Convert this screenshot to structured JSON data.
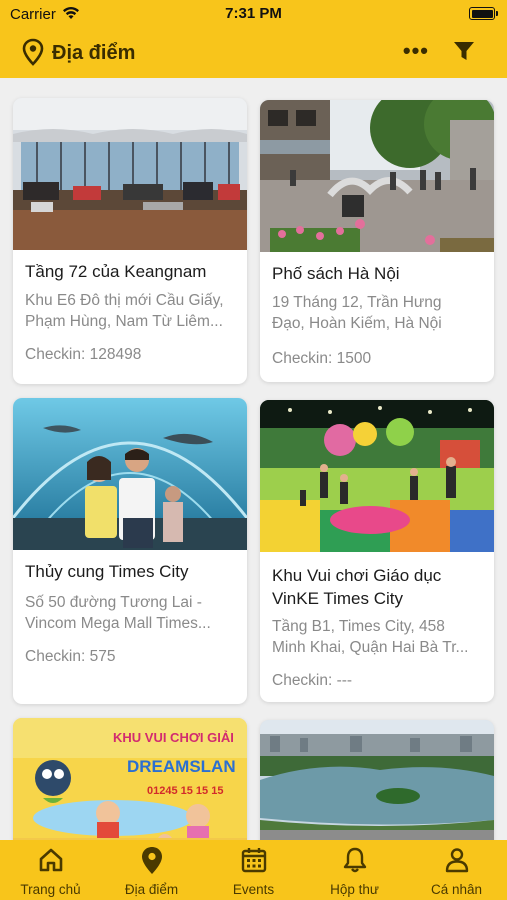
{
  "status_bar": {
    "carrier": "Carrier",
    "time": "7:31 PM",
    "wifi_icon": "wifi-icon",
    "battery_icon": "battery-icon"
  },
  "header": {
    "title": "Địa điểm",
    "title_icon": "location-pin-icon",
    "more_label": "•••",
    "filter_icon": "filter-icon",
    "background": "#f8c51b"
  },
  "places": [
    {
      "title": "Tầng 72 của Keangnam",
      "address": [
        "Khu E6 Đô thị mới Cầu Giấy,",
        "Phạm Hùng, Nam Từ Liêm..."
      ],
      "checkin": "Checkin: 128498",
      "image": "observation-deck-photo"
    },
    {
      "title": "Phố sách Hà Nội",
      "address": [
        "19 Tháng 12, Trần Hưng",
        "Đạo, Hoàn Kiếm, Hà Nội"
      ],
      "checkin": "Checkin: 1500",
      "image": "book-street-photo"
    },
    {
      "title": "Thủy cung Times City",
      "address": [
        "Số 50 đường Tương Lai -",
        "Vincom Mega Mall Times..."
      ],
      "checkin": "Checkin: 575",
      "image": "aquarium-photo"
    },
    {
      "title": "Khu Vui chơi Giáo dục VinKE Times City",
      "title_lines": [
        "Khu Vui chơi Giáo dục",
        "VinKE Times City"
      ],
      "address": [
        "Tầng B1, Times City, 458",
        "Minh Khai, Quận Hai Bà Tr..."
      ],
      "checkin": "Checkin: ---",
      "image": "playground-photo"
    },
    {
      "image": "dreamsland-photo",
      "image_text": [
        "KHU VUI CHƠI GIẢI",
        "DREAMSLAN",
        "01245 15 15 15"
      ]
    },
    {
      "image": "hanoi-lake-photo"
    }
  ],
  "tabs": [
    {
      "label": "Trang chủ",
      "icon": "home-icon",
      "active": false
    },
    {
      "label": "Địa điểm",
      "icon": "location-pin-icon",
      "active": true
    },
    {
      "label": "Events",
      "icon": "calendar-icon",
      "active": false
    },
    {
      "label": "Hộp thư",
      "icon": "bell-icon",
      "active": false
    },
    {
      "label": "Cá nhân",
      "icon": "person-icon",
      "active": false
    }
  ]
}
